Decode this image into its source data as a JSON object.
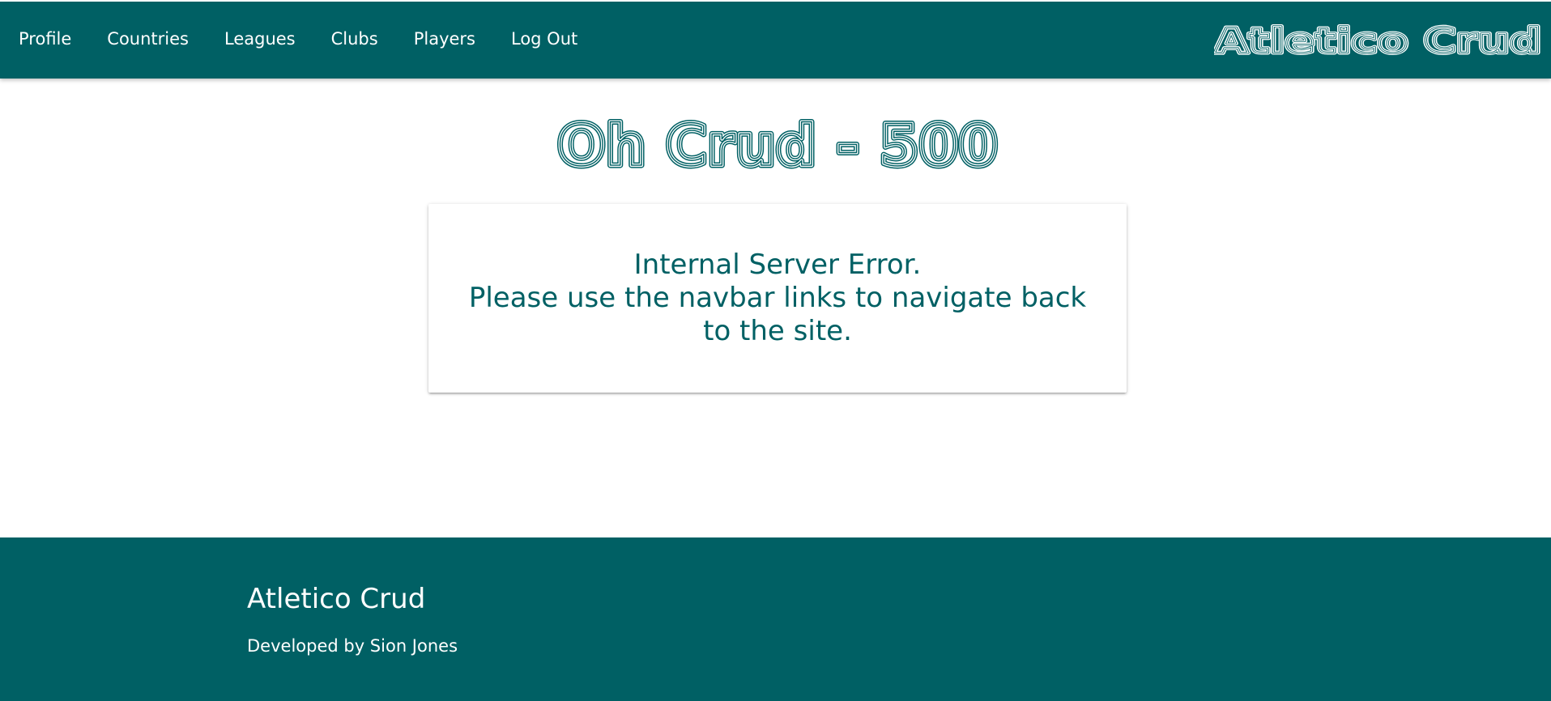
{
  "nav": {
    "links": [
      "Profile",
      "Countries",
      "Leagues",
      "Clubs",
      "Players",
      "Log Out"
    ],
    "brand": "Atletico Crud"
  },
  "main": {
    "title": "Oh Crud - 500",
    "error_line1": "Internal Server Error.",
    "error_line2": "Please use the navbar links to navigate back to the site."
  },
  "footer": {
    "title": "Atletico Crud",
    "credit": "Developed by Sion Jones"
  },
  "colors": {
    "primary": "#006064",
    "text_light": "#ffffff",
    "background": "#ffffff"
  }
}
